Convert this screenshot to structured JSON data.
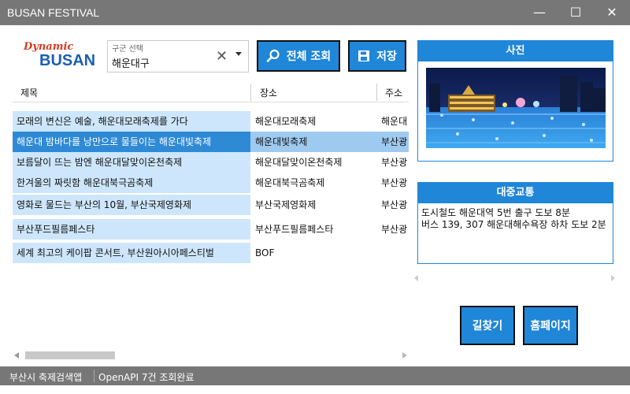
{
  "window": {
    "title": "BUSAN FESTIVAL",
    "controls": {
      "minimize": "—",
      "maximize": "☐",
      "close": "✕"
    }
  },
  "logo": {
    "line1": "Dynamic",
    "line2": "BUSAN"
  },
  "district": {
    "label": "구군 선택",
    "value": "해운대구",
    "clear_icon": "✕"
  },
  "toolbar": {
    "search_all_label": "전체 조회",
    "save_label": "저장"
  },
  "table": {
    "headers": {
      "title": "제목",
      "place": "장소",
      "address": "주소"
    },
    "rows": [
      {
        "title": "모래의 변신은 예술, 해운대모래축제를 가다",
        "place": "해운대모래축제",
        "address": "해운대"
      },
      {
        "title": "해운대 밤바다를 낭만으로 물들이는 해운대빛축제",
        "place": "해운대빛축제",
        "address": "부산광"
      },
      {
        "title": "보름달이 뜨는 밤엔 해운대달맞이온천축제",
        "place": "해운대달맞이온천축제",
        "address": "부산광"
      },
      {
        "title": "한겨울의 짜릿함 해운대북극곰축제",
        "place": "해운대북극곰축제",
        "address": "부산광"
      },
      {
        "title": "영화로 물드는 부산의 10월, 부산국제영화제",
        "place": "부산국제영화제",
        "address": "부산광"
      },
      {
        "title": "부산푸드필름페스타",
        "place": "부산푸드필름페스타",
        "address": "부산광"
      },
      {
        "title": "세계 최고의 케이팝 콘서트, 부산원아시아페스티벌",
        "place": "BOF",
        "address": ""
      }
    ],
    "selected_index": 1
  },
  "photo_panel": {
    "title": "사진"
  },
  "transit_panel": {
    "title": "대중교통",
    "lines": [
      "도시철도 해운대역 5번 출구 도보 8분",
      "버스 139, 307 해운대해수욕장 하차 도보 2분"
    ]
  },
  "actions": {
    "directions_label": "길찾기",
    "homepage_label": "홈페이지"
  },
  "status": {
    "app_name": "부산시 축제검색앱",
    "message": "OpenAPI 7건 조회완료"
  },
  "colors": {
    "accent": "#1f86d8",
    "row_bg": "#cde6fb",
    "row_selected": "#2f8ad6",
    "chrome_gray": "#777777"
  }
}
